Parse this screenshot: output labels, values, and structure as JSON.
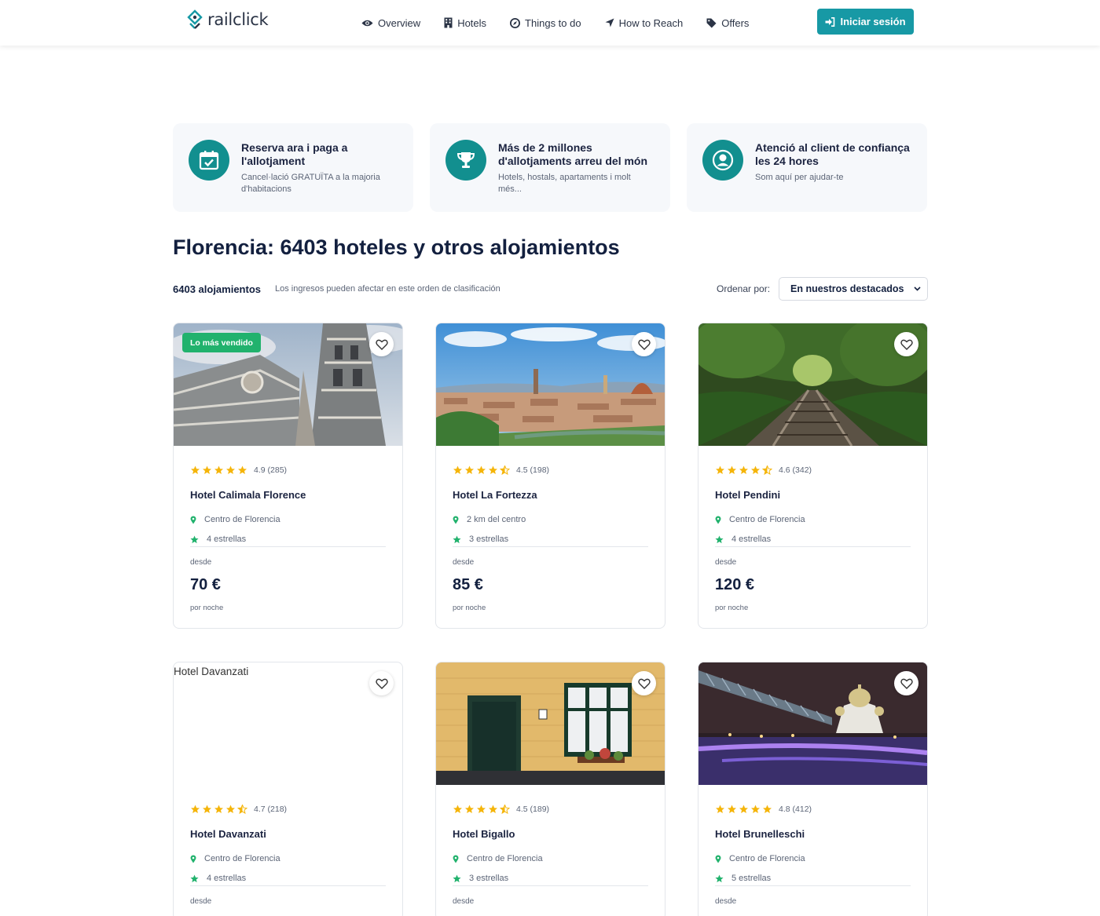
{
  "brand": {
    "name": "railclick",
    "accent": "#1799a5"
  },
  "nav": [
    {
      "label": "Overview",
      "icon": "eye-icon"
    },
    {
      "label": "Hotels",
      "icon": "building-icon"
    },
    {
      "label": "Things to do",
      "icon": "compass-icon"
    },
    {
      "label": "How to Reach",
      "icon": "location-arrow-icon"
    },
    {
      "label": "Offers",
      "icon": "tag-icon"
    }
  ],
  "login": {
    "label": "Iniciar sesión",
    "icon": "sign-in-icon"
  },
  "features": [
    {
      "title": "Reserva ara i paga a l'allotjament",
      "subtitle": "Cancel·lació GRATUÏTA a la majoria d'habitacions",
      "icon": "calendar-check-icon"
    },
    {
      "title": "Más de 2 millones d'allotjaments arreu del món",
      "subtitle": "Hotels, hostals, apartaments i molt més...",
      "icon": "trophy-icon"
    },
    {
      "title": "Atenció al client de confiança les 24 hores",
      "subtitle": "Som aquí per ajudar-te",
      "icon": "user-circle-icon"
    }
  ],
  "results": {
    "title": "Florencia: 6403 hoteles y otros alojamientos",
    "count": "6403 alojamientos",
    "disclaimer": "Los ingresos pueden afectar en este orden de clasificación",
    "sort_label": "Ordenar por:",
    "sort_value": "En nuestros destacados"
  },
  "labels": {
    "from": "desde",
    "per_night": "por noche"
  },
  "hotels": [
    {
      "name": "Hotel Calimala Florence",
      "rating": 4.9,
      "rating_text": "4.9 (285)",
      "location": "Centro de Florencia",
      "category": "4 estrellas",
      "price": "70 €",
      "badge": "Lo más vendido",
      "image": "florence-cathedral"
    },
    {
      "name": "Hotel La Fortezza",
      "rating": 4.5,
      "rating_text": "4.5 (198)",
      "location": "2 km del centro",
      "category": "3 estrellas",
      "price": "85 €",
      "image": "florence-panorama"
    },
    {
      "name": "Hotel Pendini",
      "rating": 4.6,
      "rating_text": "4.6 (342)",
      "location": "Centro de Florencia",
      "category": "4 estrellas",
      "price": "120 €",
      "image": "railway-forest"
    },
    {
      "name": "Hotel Davanzati",
      "rating": 4.7,
      "rating_text": "4.7 (218)",
      "location": "Centro de Florencia",
      "category": "4 estrellas",
      "price": "",
      "image_alt": "Hotel Davanzati",
      "image": ""
    },
    {
      "name": "Hotel Bigallo",
      "rating": 4.5,
      "rating_text": "4.5 (189)",
      "location": "Centro de Florencia",
      "category": "3 estrellas",
      "price": "",
      "image": "door-window"
    },
    {
      "name": "Hotel Brunelleschi",
      "rating": 4.8,
      "rating_text": "4.8 (412)",
      "location": "Centro de Florencia",
      "category": "5 estrellas",
      "price": "",
      "image": "night-bridge"
    }
  ],
  "colors": {
    "star": "#f5b50a",
    "green": "#21b26d",
    "feature_icon_bg": "#128f8f"
  }
}
